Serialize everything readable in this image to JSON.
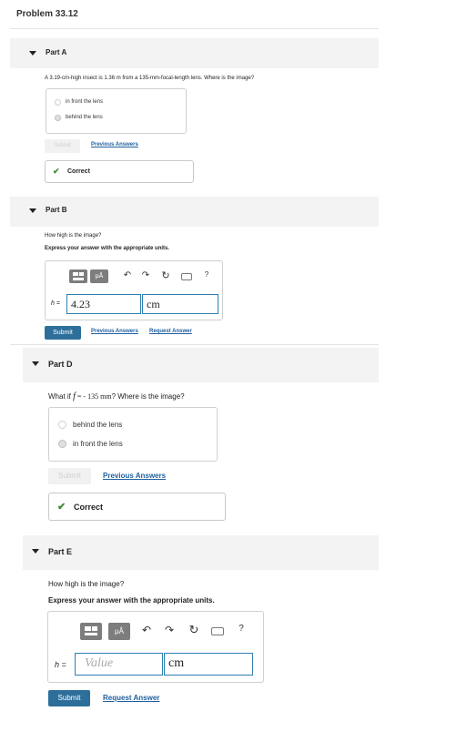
{
  "problem": {
    "title": "Problem 33.12"
  },
  "partA": {
    "label": "Part A",
    "question": "A 3.19-cm-high insect is 1.36 m from a 135-mm-focal-length lens. Where is the image?",
    "options": [
      "in front the lens",
      "behind the lens"
    ],
    "selected_index": 1,
    "submit_label": "Submit",
    "previous_answers_label": "Previous Answers",
    "feedback": "Correct"
  },
  "partB": {
    "label": "Part B",
    "question": "How high is the image?",
    "instruction": "Express your answer with the appropriate units.",
    "toolbar": {
      "template_icon": "fraction-template-icon",
      "units_label": "μÅ",
      "undo_icon": "undo-icon",
      "redo_icon": "redo-icon",
      "reset_icon": "reset-icon",
      "keyboard_icon": "keyboard-icon",
      "help_label": "?"
    },
    "var_label": "h =",
    "value": "4.23",
    "unit": "cm",
    "submit_label": "Submit",
    "previous_answers_label": "Previous Answers",
    "request_answer_label": "Request Answer"
  },
  "partD": {
    "label": "Part D",
    "question_prefix": "What if",
    "question_var": "f",
    "question_mid": " = - 135 ",
    "question_unit": "mm",
    "question_suffix": "? Where is the image?",
    "options": [
      "behind the lens",
      "in front the lens"
    ],
    "selected_index": 1,
    "submit_label": "Submit",
    "previous_answers_label": "Previous Answers",
    "feedback": "Correct"
  },
  "partE": {
    "label": "Part E",
    "question": "How high is the image?",
    "instruction": "Express your answer with the appropriate units.",
    "toolbar": {
      "units_label": "μÅ",
      "help_label": "?"
    },
    "var_label": "h =",
    "value_placeholder": "Value",
    "unit": "cm",
    "submit_label": "Submit",
    "request_answer_label": "Request Answer"
  }
}
